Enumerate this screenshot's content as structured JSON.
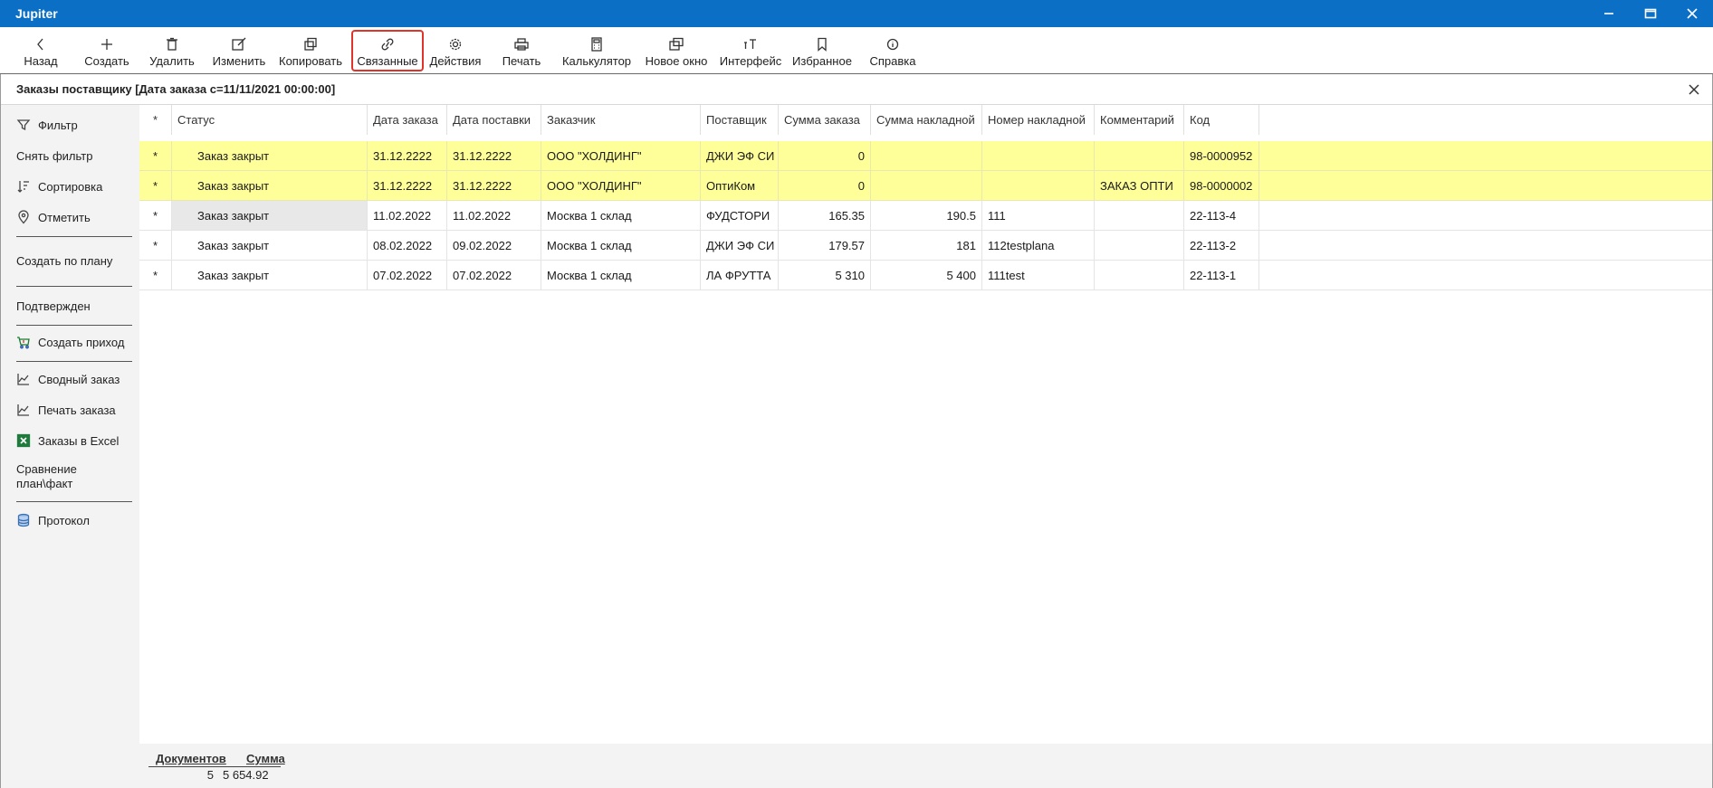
{
  "app": {
    "title": "Jupiter"
  },
  "toolbar": {
    "back": "Назад",
    "create": "Создать",
    "delete": "Удалить",
    "edit": "Изменить",
    "copy": "Копировать",
    "linked": "Связанные",
    "actions": "Действия",
    "print": "Печать",
    "calculator": "Калькулятор",
    "new_window": "Новое окно",
    "interface": "Интерфейс",
    "favorites": "Избранное",
    "help": "Справка"
  },
  "panel": {
    "title": "Заказы поставщику [Дата заказа с=11/11/2021 00:00:00]"
  },
  "sidebar": {
    "filter": "Фильтр",
    "remove_filter": "Снять фильтр",
    "sort": "Сортировка",
    "mark": "Отметить",
    "create_by_plan": "Создать по плану",
    "confirmed": "Подтвержден",
    "create_receipt": "Создать приход",
    "summary_order": "Сводный заказ",
    "print_order": "Печать заказа",
    "orders_excel": "Заказы в Excel",
    "compare_plan": "Сравнение план\\факт",
    "protocol": "Протокол"
  },
  "grid": {
    "headers": {
      "mark": "*",
      "status": "Статус",
      "order_date": "Дата заказа",
      "delivery_date": "Дата поставки",
      "customer": "Заказчик",
      "supplier": "Поставщик",
      "order_sum": "Сумма заказа",
      "invoice_sum": "Сумма накладной",
      "invoice_no": "Номер накладной",
      "comment": "Комментарий",
      "code": "Код"
    },
    "rows": [
      {
        "mark": "*",
        "status": "Заказ закрыт",
        "order_date": "31.12.2222",
        "delivery_date": "31.12.2222",
        "customer": "ООО \"ХОЛДИНГ\"",
        "supplier": "ДЖИ ЭФ СИ",
        "order_sum": "0",
        "invoice_sum": "",
        "invoice_no": "",
        "comment": "",
        "code": "98-0000952"
      },
      {
        "mark": "*",
        "status": "Заказ закрыт",
        "order_date": "31.12.2222",
        "delivery_date": "31.12.2222",
        "customer": "ООО \"ХОЛДИНГ\"",
        "supplier": "ОптиКом",
        "order_sum": "0",
        "invoice_sum": "",
        "invoice_no": "",
        "comment": "ЗАКАЗ ОПТИ",
        "code": "98-0000002"
      },
      {
        "mark": "*",
        "status": "Заказ закрыт",
        "order_date": "11.02.2022",
        "delivery_date": "11.02.2022",
        "customer": "Москва 1 склад",
        "supplier": "ФУДСТОРИ",
        "order_sum": "165.35",
        "invoice_sum": "190.5",
        "invoice_no": "111",
        "comment": "",
        "code": "22-113-4"
      },
      {
        "mark": "*",
        "status": "Заказ закрыт",
        "order_date": "08.02.2022",
        "delivery_date": "09.02.2022",
        "customer": "Москва 1 склад",
        "supplier": "ДЖИ ЭФ СИ",
        "order_sum": "179.57",
        "invoice_sum": "181",
        "invoice_no": "112testplana",
        "comment": "",
        "code": "22-113-2"
      },
      {
        "mark": "*",
        "status": "Заказ закрыт",
        "order_date": "07.02.2022",
        "delivery_date": "07.02.2022",
        "customer": "Москва 1 склад",
        "supplier": "ЛА ФРУТТА",
        "order_sum": "5 310",
        "invoice_sum": "5 400",
        "invoice_no": "111test",
        "comment": "",
        "code": "22-113-1"
      }
    ]
  },
  "footer": {
    "docs_label": "Документов",
    "sum_label": "Сумма",
    "docs_value": "5",
    "sum_value": "5 654.92"
  },
  "colors": {
    "titlebar": "#0b6fc6",
    "highlight_row": "#ffff99",
    "active_border": "#e0342b"
  }
}
